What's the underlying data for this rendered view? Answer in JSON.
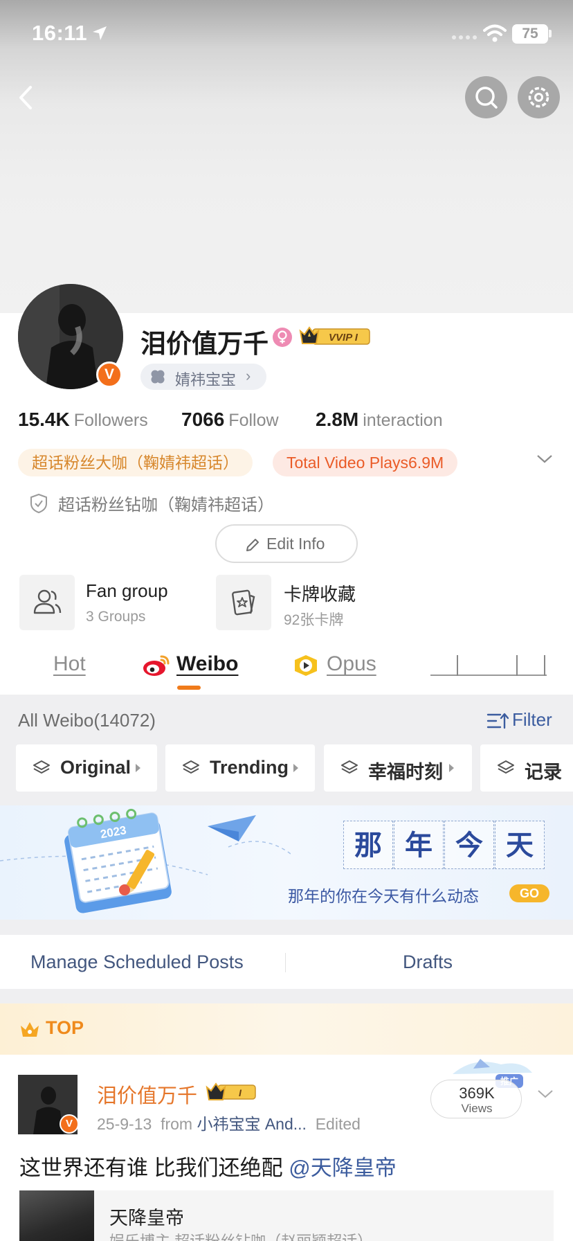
{
  "status_bar": {
    "time": "16:11",
    "battery": "75"
  },
  "profile": {
    "username": "泪价值万千",
    "vip_label": "VVIP I",
    "fan_club": "婧祎宝宝",
    "fan_club_chevron": "›",
    "verified_badge": "V",
    "stats": [
      {
        "value": "15.4K",
        "label": "Followers"
      },
      {
        "value": "7066",
        "label": "Follow"
      },
      {
        "value": "2.8M",
        "label": "interaction"
      }
    ],
    "badges": {
      "superfan": "超话粉丝大咖（鞠婧祎超话）",
      "video_plays": "Total Video Plays6.9M"
    },
    "verified_text": "超话粉丝钻咖（鞠婧祎超话）",
    "edit_info": "Edit Info",
    "tiles": [
      {
        "title": "Fan group",
        "subtitle": "3 Groups",
        "icon": "users-icon"
      },
      {
        "title": "卡牌收藏",
        "subtitle": "92张卡牌",
        "icon": "card-star-icon"
      }
    ]
  },
  "tabs": [
    {
      "label": "Hot",
      "active": false
    },
    {
      "label": "Weibo",
      "active": true
    },
    {
      "label": "Opus",
      "active": false
    }
  ],
  "feed": {
    "count_label": "All Weibo(14072)",
    "filter_label": "Filter",
    "chips": [
      "Original",
      "Trending",
      "幸福时刻",
      "记录"
    ]
  },
  "banner": {
    "title_chars": [
      "那",
      "年",
      "今",
      "天"
    ],
    "subtitle": "那年的你在今天有什么动态",
    "go": "GO",
    "calendar_year": "2023"
  },
  "manage": {
    "scheduled": "Manage Scheduled Posts",
    "drafts": "Drafts"
  },
  "post": {
    "top_label": "TOP",
    "author": "泪价值万千",
    "vip_level": "I",
    "date": "25-9-13",
    "from_label": "from",
    "source": "小祎宝宝 And...",
    "edited": "Edited",
    "promo_tag": "推广",
    "views_count": "369K",
    "views_label": "Views",
    "text": "这世界还有谁 比我们还绝配",
    "mention": "@天降皇帝",
    "repost": {
      "title": "天降皇帝",
      "subtitle": "娱乐博主 超话粉丝钻咖（赵丽颖超话）"
    }
  },
  "colors": {
    "accent_orange": "#f07b1b",
    "link_blue": "#3b5c9f",
    "vip_gold": "#f3b62b"
  }
}
